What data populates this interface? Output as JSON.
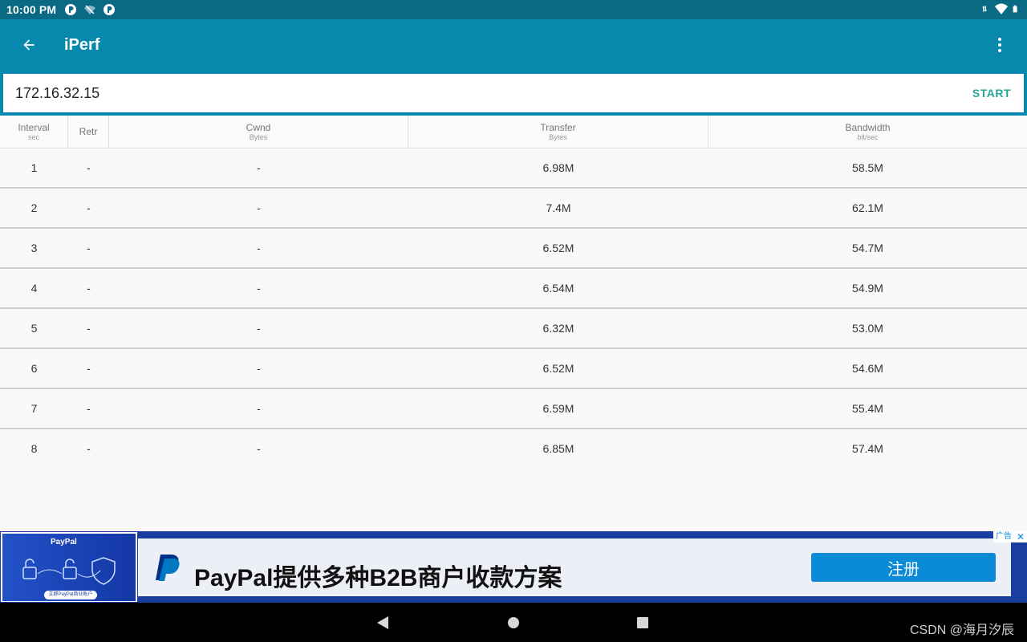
{
  "status_bar": {
    "time": "10:00 PM",
    "left_icons": [
      "app-notification-icon",
      "wifi-off-icon",
      "app-notification-icon"
    ],
    "right_icons": [
      "data-arrows-icon",
      "wifi-icon",
      "battery-icon"
    ]
  },
  "toolbar": {
    "title": "iPerf",
    "back_icon": "arrow-back-icon",
    "menu_icon": "more-vert-icon"
  },
  "host": {
    "value": "172.16.32.15",
    "start_label": "START"
  },
  "table": {
    "columns": [
      {
        "title": "Interval",
        "unit": "sec"
      },
      {
        "title": "Retr",
        "unit": ""
      },
      {
        "title": "Cwnd",
        "unit": "Bytes"
      },
      {
        "title": "Transfer",
        "unit": "Bytes"
      },
      {
        "title": "Bandwidth",
        "unit": "bit/sec"
      }
    ],
    "rows": [
      {
        "interval": "1",
        "retr": "-",
        "cwnd": "-",
        "transfer": "6.98M",
        "bandwidth": "58.5M"
      },
      {
        "interval": "2",
        "retr": "-",
        "cwnd": "-",
        "transfer": "7.4M",
        "bandwidth": "62.1M"
      },
      {
        "interval": "3",
        "retr": "-",
        "cwnd": "-",
        "transfer": "6.52M",
        "bandwidth": "54.7M"
      },
      {
        "interval": "4",
        "retr": "-",
        "cwnd": "-",
        "transfer": "6.54M",
        "bandwidth": "54.9M"
      },
      {
        "interval": "5",
        "retr": "-",
        "cwnd": "-",
        "transfer": "6.32M",
        "bandwidth": "53.0M"
      },
      {
        "interval": "6",
        "retr": "-",
        "cwnd": "-",
        "transfer": "6.52M",
        "bandwidth": "54.6M"
      },
      {
        "interval": "7",
        "retr": "-",
        "cwnd": "-",
        "transfer": "6.59M",
        "bandwidth": "55.4M"
      },
      {
        "interval": "8",
        "retr": "-",
        "cwnd": "-",
        "transfer": "6.85M",
        "bandwidth": "57.4M"
      }
    ]
  },
  "ad": {
    "left_logo_text": "PayPal",
    "left_pill_text": "立即PayPal商业账户",
    "headline": "PayPal提供多种B2B商户收款方案",
    "cta_label": "注册",
    "ad_tag": "广告",
    "close_glyph": "✕",
    "brand_color": "#0b8ad8"
  },
  "nav": {
    "back_icon": "nav-back-icon",
    "home_icon": "nav-home-icon",
    "recents_icon": "nav-recents-icon"
  },
  "watermark": "CSDN @海月汐辰",
  "colors": {
    "status_bar": "#0a6a83",
    "toolbar": "#0788ad",
    "start_accent": "#26a69a"
  }
}
